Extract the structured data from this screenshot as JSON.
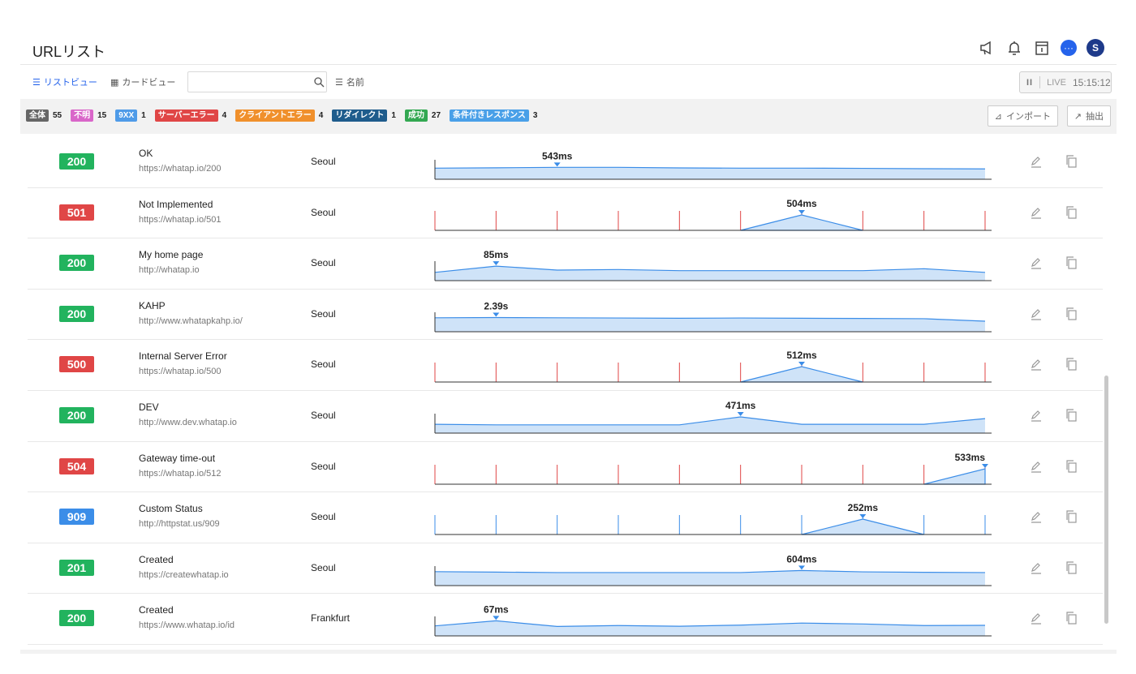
{
  "header": {
    "title": "URLリスト",
    "avatar_letter": "S",
    "icons": [
      "megaphone-icon",
      "bell-icon",
      "calendar-icon",
      "chat-icon"
    ]
  },
  "toolbar": {
    "list_view_label": "リストビュー",
    "card_view_label": "カードビュー",
    "search_value": "",
    "sort_label": "名前",
    "live_label": "LIVE",
    "live_time": "15:15:12",
    "pause_glyph": "II"
  },
  "filters": {
    "items": [
      {
        "label": "全体",
        "count": "55",
        "color": "#666666"
      },
      {
        "label": "不明",
        "count": "15",
        "color": "#d966c9"
      },
      {
        "label": "9XX",
        "count": "1",
        "color": "#4f9be8"
      },
      {
        "label": "サーバーエラー",
        "count": "4",
        "color": "#e04646"
      },
      {
        "label": "クライアントエラー",
        "count": "4",
        "color": "#f0902c"
      },
      {
        "label": "リダイレクト",
        "count": "1",
        "color": "#1e5c8c"
      },
      {
        "label": "成功",
        "count": "27",
        "color": "#33a852"
      },
      {
        "label": "条件付きレスポンス",
        "count": "3",
        "color": "#49a0e8"
      }
    ],
    "import_label": "インポート",
    "extract_label": "抽出"
  },
  "rows": [
    {
      "status": "200",
      "color": "#22b35e",
      "name": "OK",
      "url": "https://whatap.io/200",
      "location": "Seoul",
      "peak": "543ms",
      "type": "area",
      "points": [
        0.55,
        0.58,
        0.62,
        0.62,
        0.57,
        0.55,
        0.55,
        0.53,
        0.5,
        0.48
      ]
    },
    {
      "status": "501",
      "color": "#e04646",
      "name": "Not Implemented",
      "url": "https://whatap.io/501",
      "location": "Seoul",
      "peak": "504ms",
      "type": "ticks",
      "tickColor": "#e04646",
      "points": [
        0,
        0,
        0,
        0,
        0,
        0,
        1,
        0,
        0,
        0
      ]
    },
    {
      "status": "200",
      "color": "#22b35e",
      "name": "My home page",
      "url": "http://whatap.io",
      "location": "Seoul",
      "peak": "85ms",
      "type": "area",
      "points": [
        0.3,
        0.85,
        0.5,
        0.55,
        0.45,
        0.45,
        0.45,
        0.45,
        0.62,
        0.3
      ]
    },
    {
      "status": "200",
      "color": "#22b35e",
      "name": "KAHP",
      "url": "http://www.whatapkahp.io/",
      "location": "Seoul",
      "peak": "2.39s",
      "type": "area",
      "points": [
        0.8,
        0.82,
        0.8,
        0.78,
        0.76,
        0.78,
        0.76,
        0.74,
        0.72,
        0.5
      ]
    },
    {
      "status": "500",
      "color": "#e04646",
      "name": "Internal Server Error",
      "url": "https://whatap.io/500",
      "location": "Seoul",
      "peak": "512ms",
      "type": "ticks",
      "tickColor": "#e04646",
      "points": [
        0,
        0,
        0,
        0,
        0,
        0,
        1,
        0,
        0,
        0
      ]
    },
    {
      "status": "200",
      "color": "#22b35e",
      "name": "DEV",
      "url": "http://www.dev.whatap.io",
      "location": "Seoul",
      "peak": "471ms",
      "type": "area",
      "points": [
        0.35,
        0.3,
        0.3,
        0.3,
        0.3,
        1.0,
        0.35,
        0.35,
        0.35,
        0.85
      ]
    },
    {
      "status": "504",
      "color": "#e04646",
      "name": "Gateway time-out",
      "url": "https://whatap.io/512",
      "location": "Seoul",
      "peak": "533ms",
      "type": "ticks",
      "tickColor": "#e04646",
      "points": [
        0,
        0,
        0,
        0,
        0,
        0,
        0,
        0,
        0,
        1
      ]
    },
    {
      "status": "909",
      "color": "#3b8de8",
      "name": "Custom Status",
      "url": "http://httpstat.us/909",
      "location": "Seoul",
      "peak": "252ms",
      "type": "ticks",
      "tickColor": "#3b8de8",
      "points": [
        0,
        0,
        0,
        0,
        0,
        0,
        0,
        1,
        0,
        0
      ]
    },
    {
      "status": "201",
      "color": "#22b35e",
      "name": "Created",
      "url": "https://createwhatap.io",
      "location": "Seoul",
      "peak": "604ms",
      "type": "area",
      "points": [
        0.8,
        0.76,
        0.72,
        0.72,
        0.72,
        0.72,
        0.9,
        0.78,
        0.74,
        0.72
      ]
    },
    {
      "status": "200",
      "color": "#22b35e",
      "name": "Created",
      "url": "https://www.whatap.io/id",
      "location": "Frankfurt",
      "peak": "67ms",
      "type": "area",
      "points": [
        0.45,
        0.9,
        0.4,
        0.48,
        0.42,
        0.52,
        0.7,
        0.62,
        0.48,
        0.5
      ]
    }
  ]
}
